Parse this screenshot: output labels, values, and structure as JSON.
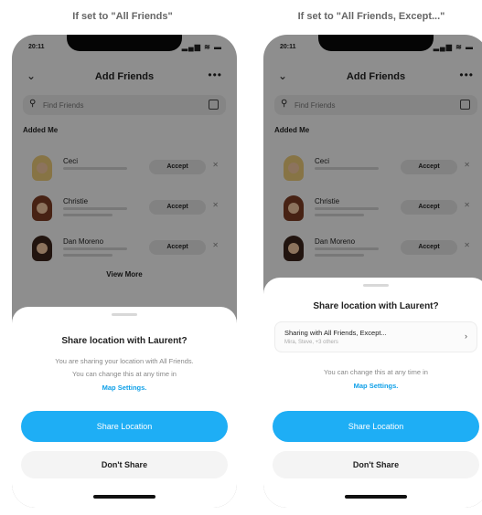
{
  "captions": {
    "left": "If set to \"All Friends\"",
    "right": "If set to \"All Friends, Except...\""
  },
  "phone_left": {
    "status": {
      "time": "20:11",
      "signal": "▂▄▆ ≋ ▬"
    },
    "header": {
      "back_icon": "chevron-down-icon",
      "title": "Add Friends",
      "more": "•••"
    },
    "search": {
      "placeholder": "Find Friends"
    },
    "section": "Added Me",
    "rows": [
      {
        "name": "Ceci",
        "button": "Accept"
      },
      {
        "name": "Christie",
        "button": "Accept"
      },
      {
        "name": "Dan Moreno",
        "button": "Accept"
      }
    ],
    "view_more": "View More",
    "sheet": {
      "title": "Share location with Laurent?",
      "body_line1": "You are sharing your location with All Friends.",
      "body_line2": "You can change this at any time in",
      "link": "Map Settings.",
      "primary": "Share Location",
      "secondary": "Don't Share"
    }
  },
  "phone_right": {
    "status": {
      "time": "20:11",
      "signal": "▂▄▆ ≋ ▬"
    },
    "header": {
      "back_icon": "chevron-down-icon",
      "title": "Add Friends",
      "more": "•••"
    },
    "search": {
      "placeholder": "Find Friends"
    },
    "section": "Added Me",
    "rows": [
      {
        "name": "Ceci",
        "button": "Accept"
      },
      {
        "name": "Christie",
        "button": "Accept"
      },
      {
        "name": "Dan Moreno",
        "button": "Accept"
      }
    ],
    "sheet": {
      "title": "Share location with Laurent?",
      "option_title": "Sharing with All Friends, Except...",
      "option_sub": "Mira, Steve, +3 others",
      "body_line1": "You can change this at any time in",
      "link": "Map Settings.",
      "primary": "Share Location",
      "secondary": "Don't Share"
    }
  },
  "colors": {
    "accent": "#1eaef5",
    "link": "#0fa0e8"
  }
}
